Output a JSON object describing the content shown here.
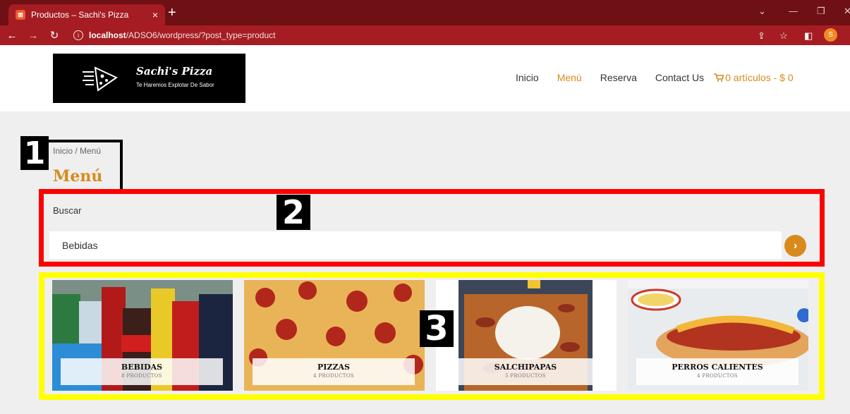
{
  "browser": {
    "tab_title": "Productos – Sachi's Pizza",
    "tab_close": "×",
    "new_tab": "+",
    "url_host": "localhost",
    "url_path": "/ADSO6/wordpress/?post_type=product",
    "profile_initial": "S",
    "accent_color": "#a51d22"
  },
  "site": {
    "logo_name": "Sachi's Pizza",
    "logo_tagline": "Te Haremos Explotar De Sabor",
    "nav": [
      {
        "label": "Inicio"
      },
      {
        "label": "Menú"
      },
      {
        "label": "Reserva"
      },
      {
        "label": "Contact Us"
      }
    ],
    "cart_label": "0 artículos - $ 0",
    "brand_color": "#d98a1d"
  },
  "annotations": {
    "one": "1",
    "two": "2",
    "three": "3"
  },
  "page": {
    "breadcrumb": "Inicio / Menú",
    "title": "Menú"
  },
  "search": {
    "label": "Buscar",
    "value": "Bebidas",
    "button_icon": "chevron-right-icon"
  },
  "categories": [
    {
      "name": "BEBIDAS",
      "count": "8 PRODUCTOS"
    },
    {
      "name": "PIZZAS",
      "count": "4 PRODUCTOS"
    },
    {
      "name": "SALCHIPAPAS",
      "count": "5 PRODUCTOS"
    },
    {
      "name": "PERROS CALIENTES",
      "count": "4 PRODUCTOS"
    }
  ]
}
